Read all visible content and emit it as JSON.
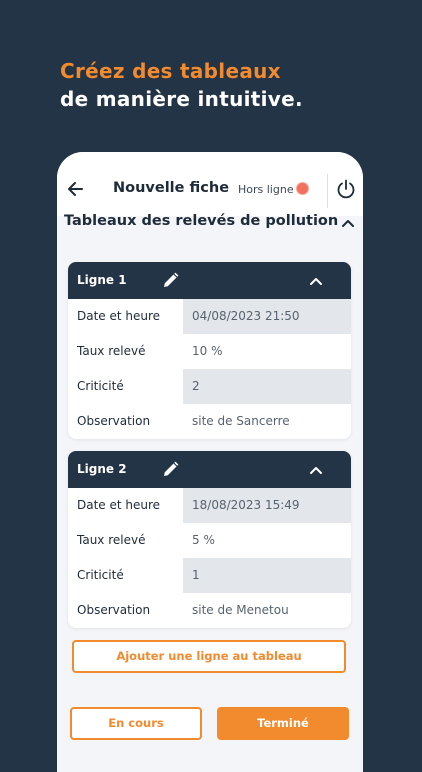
{
  "marketing": {
    "line1": "Créez des tableaux",
    "line2": "de manière intuitive."
  },
  "appbar": {
    "title": "Nouvelle fiche",
    "offline_label": "Hors ligne"
  },
  "section": {
    "title": "Tableaux des relevés de pollution"
  },
  "cards": [
    {
      "title": "Ligne 1",
      "rows": [
        {
          "label": "Date et heure",
          "value": "04/08/2023 21:50"
        },
        {
          "label": "Taux relevé",
          "value": "10 %"
        },
        {
          "label": "Criticité",
          "value": "2"
        },
        {
          "label": "Observation",
          "value": "site de Sancerre"
        }
      ]
    },
    {
      "title": "Ligne 2",
      "rows": [
        {
          "label": "Date et heure",
          "value": "18/08/2023 15:49"
        },
        {
          "label": "Taux relevé",
          "value": "5 %"
        },
        {
          "label": "Criticité",
          "value": "1"
        },
        {
          "label": "Observation",
          "value": "site de Menetou"
        }
      ]
    }
  ],
  "buttons": {
    "add_row": "Ajouter une ligne au tableau",
    "in_progress": "En cours",
    "done": "Terminé"
  },
  "icons": {
    "back": "arrow-back-icon",
    "status": "status-dot-icon",
    "power": "power-icon",
    "collapse": "chevron-up-icon",
    "edit": "pencil-icon"
  },
  "colors": {
    "background": "#233446",
    "accent": "#F28A2E",
    "status_offline": "#F2705F",
    "card_header": "#233446",
    "shaded_field": "#E3E6EA"
  }
}
